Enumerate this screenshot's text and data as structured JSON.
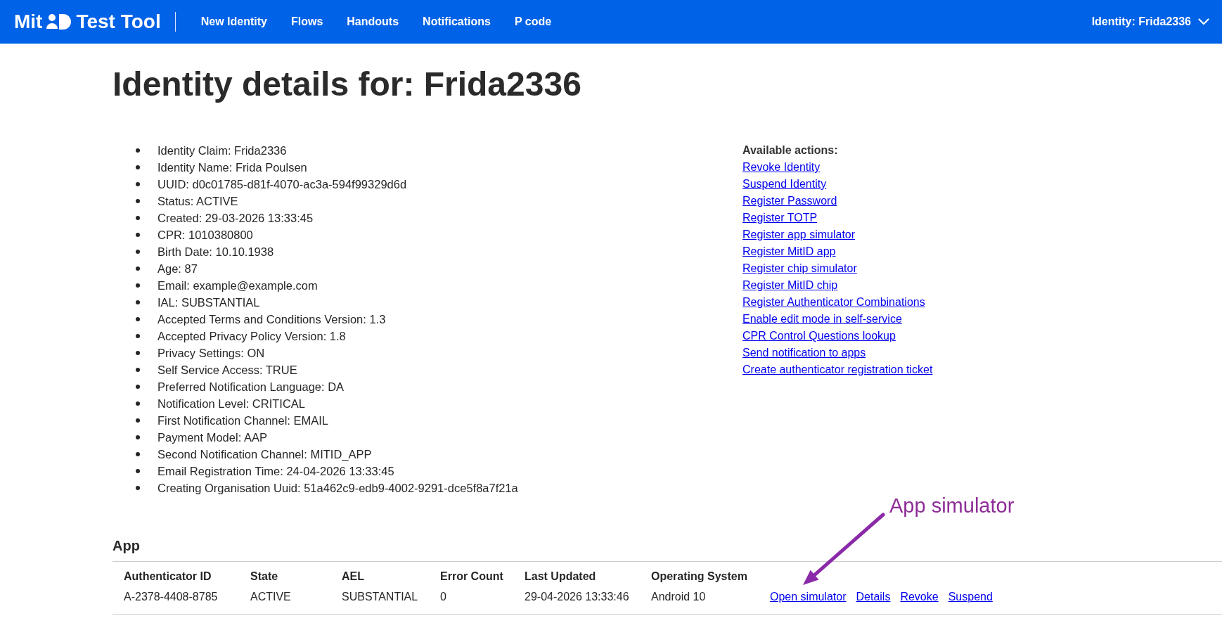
{
  "header": {
    "brand": {
      "prefix": "Mit",
      "name": "Test Tool"
    },
    "nav": [
      "New Identity",
      "Flows",
      "Handouts",
      "Notifications",
      "P code"
    ],
    "identity_menu": {
      "label": "Identity: Frida2336"
    }
  },
  "title": "Identity details for: Frida2336",
  "details": [
    "Identity Claim: Frida2336",
    "Identity Name: Frida Poulsen",
    "UUID: d0c01785-d81f-4070-ac3a-594f99329d6d",
    "Status: ACTIVE",
    "Created: 29-03-2026 13:33:45",
    "CPR: 1010380800",
    "Birth Date: 10.10.1938",
    "Age: 87",
    "Email: example@example.com",
    "IAL: SUBSTANTIAL",
    "Accepted Terms and Conditions Version: 1.3",
    "Accepted Privacy Policy Version: 1.8",
    "Privacy Settings: ON",
    "Self Service Access: TRUE",
    "Preferred Notification Language: DA",
    "Notification Level: CRITICAL",
    "First Notification Channel: EMAIL",
    "Payment Model: AAP",
    "Second Notification Channel: MITID_APP",
    "Email Registration Time: 24-04-2026 13:33:45",
    "Creating Organisation Uuid: 51a462c9-edb9-4002-9291-dce5f8a7f21a"
  ],
  "actions": {
    "heading": "Available actions:",
    "links": [
      "Revoke Identity",
      "Suspend Identity",
      "Register Password",
      "Register TOTP",
      "Register app simulator",
      "Register MitID app",
      "Register chip simulator",
      "Register MitID chip",
      "Register Authenticator Combinations",
      "Enable edit mode in self-service",
      "CPR Control Questions lookup",
      "Send notification to apps",
      "Create authenticator registration ticket"
    ]
  },
  "app": {
    "heading": "App",
    "table": {
      "columns": [
        "Authenticator ID",
        "State",
        "AEL",
        "Error Count",
        "Last Updated",
        "Operating System"
      ],
      "rows": [
        {
          "cells": [
            "A-2378-4408-8785",
            "ACTIVE",
            "SUBSTANTIAL",
            "0",
            "29-04-2026 13:33:46",
            "Android 10"
          ],
          "links": [
            "Open simulator",
            "Details",
            "Revoke",
            "Suspend"
          ]
        }
      ]
    }
  },
  "annotation": {
    "text": "App simulator"
  }
}
